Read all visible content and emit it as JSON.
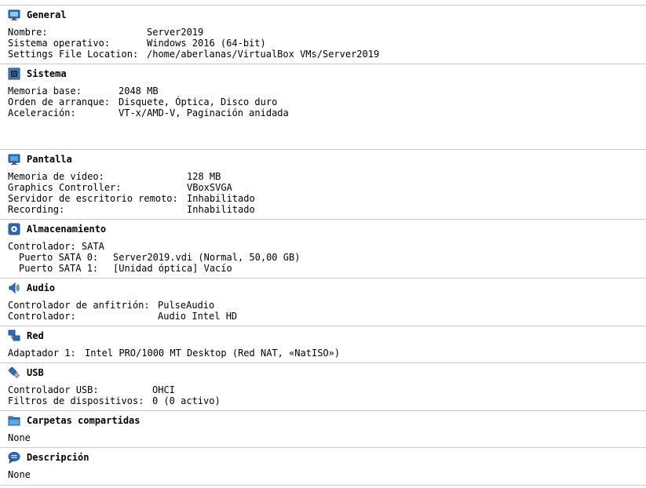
{
  "general": {
    "title": "General",
    "icon": "monitor-icon",
    "rows": [
      {
        "key": "Nombre:",
        "value": "Server2019"
      },
      {
        "key": "Sistema operativo:",
        "value": "Windows 2016 (64-bit)"
      },
      {
        "key": "Settings File Location:",
        "value": "/home/aberlanas/VirtualBox VMs/Server2019"
      }
    ]
  },
  "sistema": {
    "title": "Sistema",
    "icon": "chip-icon",
    "rows": [
      {
        "key": "Memoria base:",
        "value": "2048 MB"
      },
      {
        "key": "Orden de arranque:",
        "value": "Disquete, Óptica, Disco duro"
      },
      {
        "key": "Aceleración:",
        "value": "VT-x/AMD-V, Paginación anidada"
      }
    ]
  },
  "pantalla": {
    "title": "Pantalla",
    "icon": "display-icon",
    "rows": [
      {
        "key": "Memoria de vídeo:",
        "value": "128 MB"
      },
      {
        "key": "Graphics Controller:",
        "value": "VBoxSVGA"
      },
      {
        "key": "Servidor de escritorio remoto:",
        "value": "Inhabilitado"
      },
      {
        "key": "Recording:",
        "value": "Inhabilitado"
      }
    ]
  },
  "almacenamiento": {
    "title": "Almacenamiento",
    "icon": "storage-disk-icon",
    "controller": "Controlador: SATA",
    "rows": [
      {
        "key": "Puerto SATA 0:",
        "value": "Server2019.vdi (Normal, 50,00 GB)"
      },
      {
        "key": "Puerto SATA 1:",
        "value": "[Unidad óptica] Vacío"
      }
    ]
  },
  "audio": {
    "title": "Audio",
    "icon": "speaker-icon",
    "rows": [
      {
        "key": "Controlador de anfitrión:",
        "value": "PulseAudio"
      },
      {
        "key": "Controlador:",
        "value": "Audio Intel HD"
      }
    ]
  },
  "red": {
    "title": "Red",
    "icon": "network-icon",
    "rows": [
      {
        "key": "Adaptador 1:",
        "value": "Intel PRO/1000 MT Desktop (Red NAT, «NatISO»)"
      }
    ]
  },
  "usb": {
    "title": "USB",
    "icon": "usb-icon",
    "rows": [
      {
        "key": "Controlador USB:",
        "value": "OHCI"
      },
      {
        "key": "Filtros de dispositivos:",
        "value": "0 (0 activo)"
      }
    ]
  },
  "carpetas": {
    "title": "Carpetas compartidas",
    "icon": "folder-icon",
    "value": "None"
  },
  "descripcion": {
    "title": "Descripción",
    "icon": "speech-bubble-icon",
    "value": "None"
  }
}
